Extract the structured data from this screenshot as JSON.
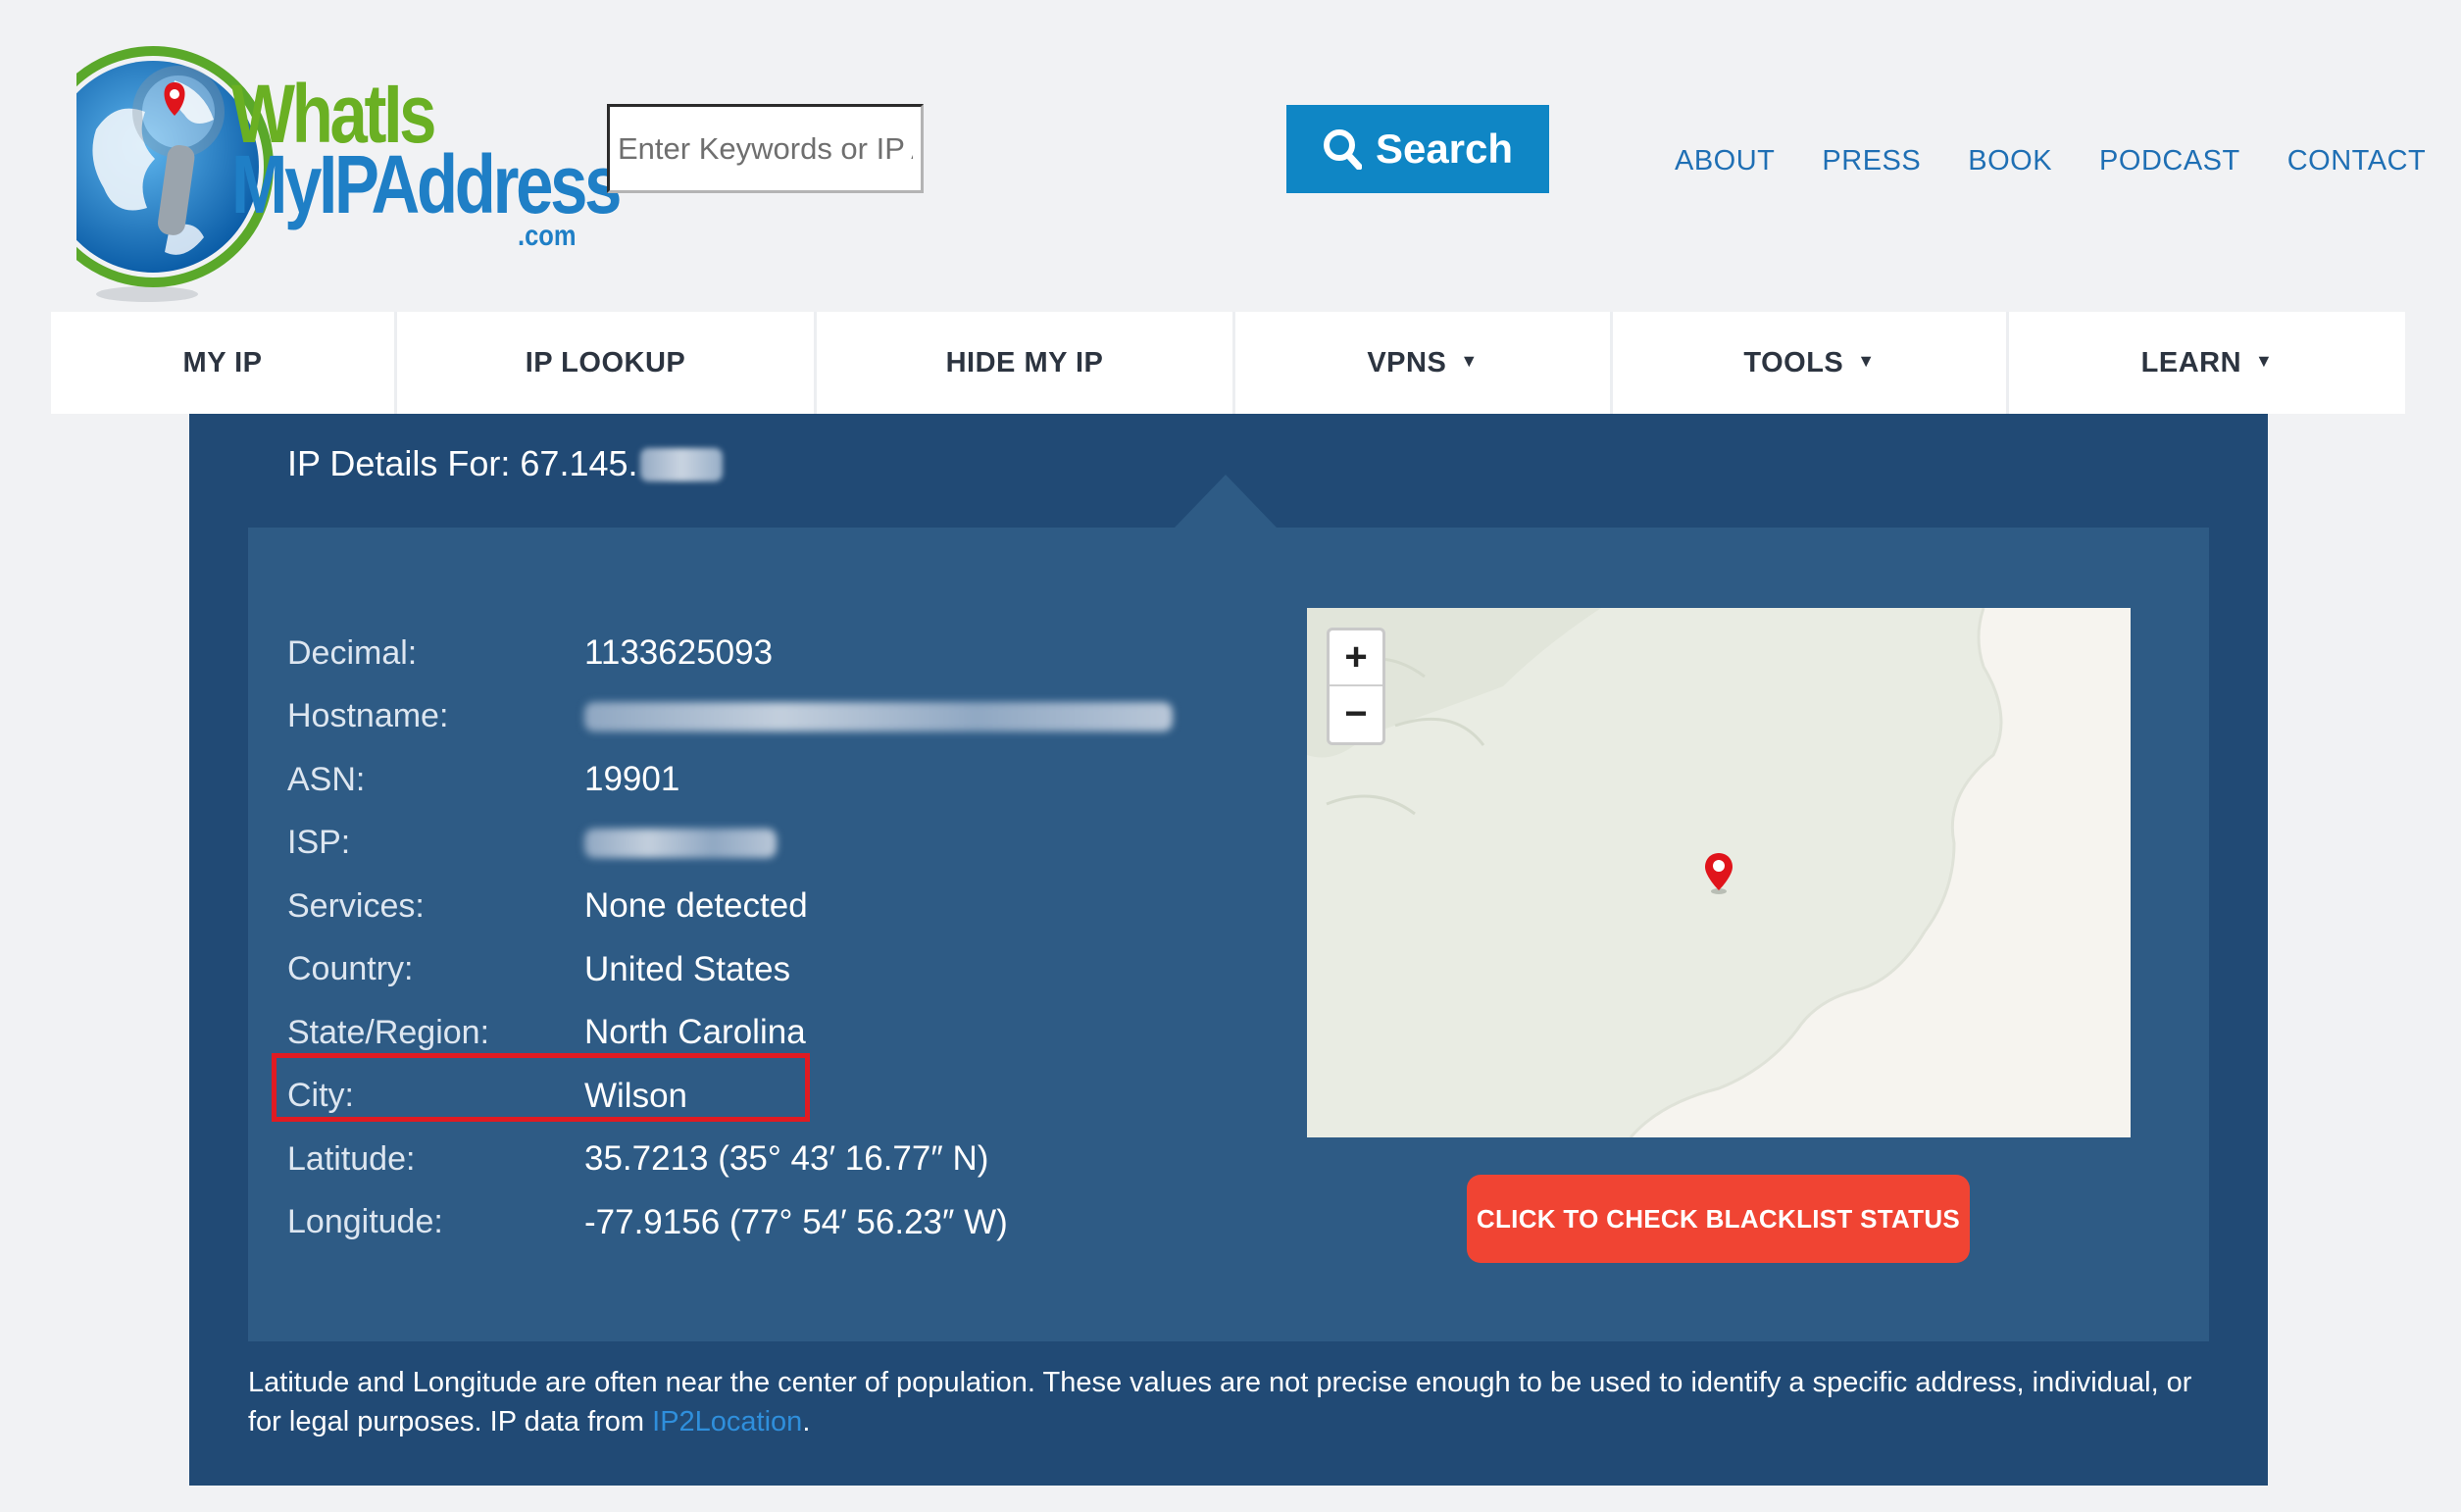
{
  "brand": {
    "logo_line1": "WhatIs",
    "logo_line2": "MyIPAddress",
    "logo_line3": ".com",
    "colors": {
      "green": "#6ab023",
      "blue": "#1f7fc6"
    }
  },
  "search": {
    "placeholder": "Enter Keywords or IP Address",
    "button_label": "Search",
    "button_icon": "search-icon"
  },
  "top_links": [
    "ABOUT",
    "PRESS",
    "BOOK",
    "PODCAST",
    "CONTACT"
  ],
  "nav": [
    {
      "label": "MY IP"
    },
    {
      "label": "IP LOOKUP"
    },
    {
      "label": "HIDE MY IP"
    },
    {
      "label": "VPNS",
      "dropdown": true
    },
    {
      "label": "TOOLS",
      "dropdown": true
    },
    {
      "label": "LEARN",
      "dropdown": true
    }
  ],
  "details": {
    "title_prefix": "IP Details For: 67.145.",
    "rows": [
      {
        "label": "Decimal:",
        "value": "1133625093"
      },
      {
        "label": "Hostname:",
        "value": "",
        "redacted": true
      },
      {
        "label": "ASN:",
        "value": "19901"
      },
      {
        "label": "ISP:",
        "value": "",
        "redacted": true
      },
      {
        "label": "Services:",
        "value": "None detected"
      },
      {
        "label": "Country:",
        "value": "United States",
        "highlighted": true
      },
      {
        "label": "State/Region:",
        "value": "North Carolina"
      },
      {
        "label": "City:",
        "value": "Wilson"
      },
      {
        "label": "Latitude:",
        "value": "35.7213 (35° 43′ 16.77″ N)"
      },
      {
        "label": "Longitude:",
        "value": "-77.9156 (77° 54′ 56.23″ W)"
      }
    ]
  },
  "map": {
    "zoom_in": "+",
    "zoom_out": "−",
    "marker_icon": "map-pin-icon",
    "colors": {
      "land": "#e9ece3",
      "water": "#f6f4ef",
      "marker": "#e0141b"
    }
  },
  "blacklist_button": "CLICK TO CHECK BLACKLIST STATUS",
  "note": {
    "text": "Latitude and Longitude are often near the center of population. These values are not precise enough to be used to identify a specific address, individual, or for legal purposes. IP data from ",
    "link": "IP2Location",
    "suffix": "."
  }
}
